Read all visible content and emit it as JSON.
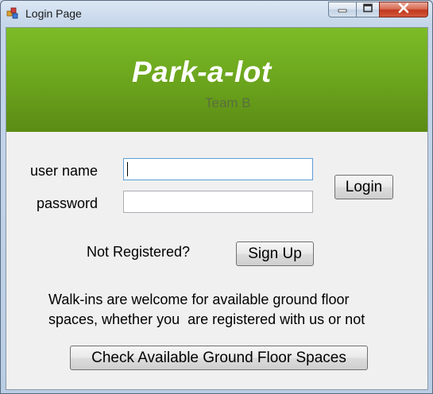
{
  "window": {
    "title": "Login Page",
    "icon": "form-icon",
    "controls": [
      "minimize-icon",
      "maximize-icon",
      "close-icon"
    ]
  },
  "banner": {
    "title": "Park-a-lot",
    "subtitle": "Team B",
    "color": "#6aa31c"
  },
  "form": {
    "username_label": "user name",
    "username_value": "",
    "password_label": "password",
    "password_value": "",
    "login_label": "Login"
  },
  "register": {
    "prompt": "Not Registered?",
    "signup_label": "Sign Up"
  },
  "walkin": {
    "line1": "Walk-ins are welcome for available ground floor",
    "line2": "spaces, whether you  are registered with us or not"
  },
  "check_button_label": "Check Available Ground Floor Spaces"
}
